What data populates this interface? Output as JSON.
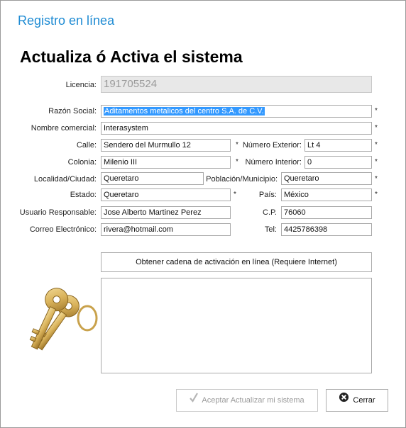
{
  "window": {
    "title": "Registro en línea"
  },
  "heading": "Actualiza ó Activa el sistema",
  "form": {
    "licencia": {
      "label": "Licencia:",
      "value": "191705524"
    },
    "razon_social": {
      "label": "Razón Social:",
      "value": "Aditamentos metalicos del centro S.A. de C.V."
    },
    "nombre_comercial": {
      "label": "Nombre comercial:",
      "value": "Interasystem"
    },
    "calle": {
      "label": "Calle:",
      "value": "Sendero del Murmullo 12"
    },
    "numero_exterior": {
      "label": "Número Exterior:",
      "value": "Lt 4"
    },
    "colonia": {
      "label": "Colonia:",
      "value": "Milenio III"
    },
    "numero_interior": {
      "label": "Número Interior:",
      "value": "0"
    },
    "localidad": {
      "label": "Localidad/Ciudad:",
      "value": "Queretaro"
    },
    "poblacion": {
      "label": "Población/Municipio:",
      "value": "Queretaro"
    },
    "estado": {
      "label": "Estado:",
      "value": "Queretaro"
    },
    "pais": {
      "label": "País:",
      "value": "México"
    },
    "usuario": {
      "label": "Usuario Responsable:",
      "value": "Jose Alberto Martinez Perez"
    },
    "cp": {
      "label": "C.P.",
      "value": "76060"
    },
    "correo": {
      "label": "Correo Electrónico:",
      "value": "rivera@hotmail.com"
    },
    "tel": {
      "label": "Tel:",
      "value": "4425786398"
    },
    "required_mark": "*"
  },
  "buttons": {
    "obtener": "Obtener cadena de activación en línea (Requiere Internet)",
    "aceptar": "Aceptar Actualizar mi sistema",
    "cerrar": "Cerrar"
  },
  "icons": {
    "keys": "keys-icon",
    "check": "check-icon",
    "close": "close-circle-icon"
  },
  "colors": {
    "title": "#1e8bd3",
    "selection": "#3399ff",
    "key_gold": "#d9b25a"
  }
}
